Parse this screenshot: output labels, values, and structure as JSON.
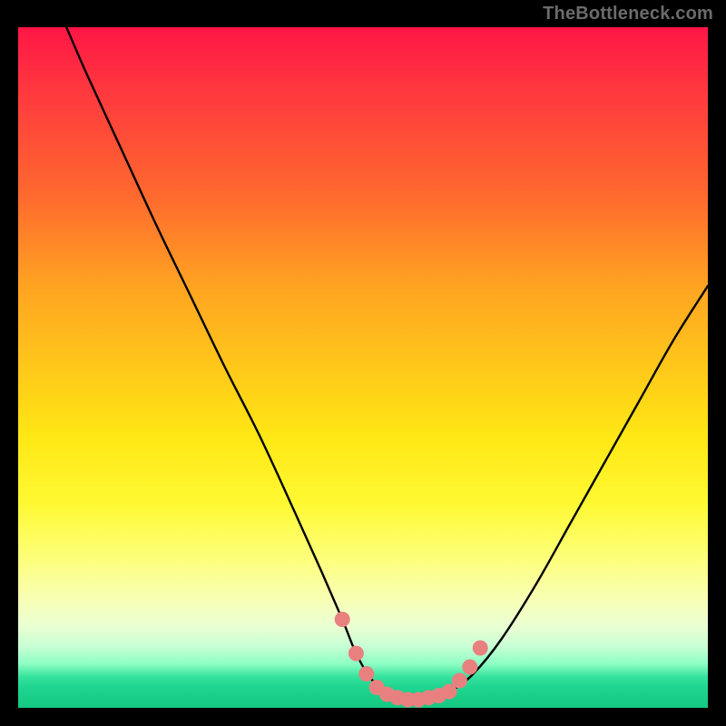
{
  "watermark": "TheBottleneck.com",
  "chart_data": {
    "type": "line",
    "title": "",
    "xlabel": "",
    "ylabel": "",
    "xlim": [
      0,
      100
    ],
    "ylim": [
      0,
      100
    ],
    "gradient_stops": [
      {
        "pos": 0,
        "color": "#ff1646"
      },
      {
        "pos": 0.1,
        "color": "#ff3a3e"
      },
      {
        "pos": 0.25,
        "color": "#ff6a2e"
      },
      {
        "pos": 0.38,
        "color": "#ffa321"
      },
      {
        "pos": 0.5,
        "color": "#ffc81a"
      },
      {
        "pos": 0.6,
        "color": "#ffe714"
      },
      {
        "pos": 0.7,
        "color": "#fff933"
      },
      {
        "pos": 0.78,
        "color": "#fdff7a"
      },
      {
        "pos": 0.84,
        "color": "#f8ffb4"
      },
      {
        "pos": 0.88,
        "color": "#eaffd2"
      },
      {
        "pos": 0.91,
        "color": "#c8ffd5"
      },
      {
        "pos": 0.935,
        "color": "#8effc3"
      },
      {
        "pos": 0.955,
        "color": "#34e29d"
      },
      {
        "pos": 0.97,
        "color": "#1fd58f"
      },
      {
        "pos": 0.985,
        "color": "#19cf88"
      },
      {
        "pos": 1.0,
        "color": "#15c982"
      }
    ],
    "series": [
      {
        "name": "bottleneck-curve",
        "x": [
          7,
          10,
          15,
          20,
          25,
          30,
          35,
          40,
          44,
          47,
          49,
          51,
          53,
          55,
          57,
          59,
          61,
          63,
          66,
          70,
          75,
          80,
          85,
          90,
          95,
          100
        ],
        "y": [
          100,
          93,
          82,
          71,
          60.5,
          50,
          40,
          29,
          20,
          13,
          8,
          4.5,
          2.5,
          1.6,
          1.2,
          1.2,
          1.6,
          2.6,
          5,
          10,
          18,
          27,
          36,
          45,
          54,
          62
        ]
      }
    ],
    "markers": {
      "name": "trough-markers",
      "color": "#e98080",
      "points": [
        {
          "x": 47,
          "y": 13
        },
        {
          "x": 49,
          "y": 8
        },
        {
          "x": 50.5,
          "y": 5
        },
        {
          "x": 52,
          "y": 3
        },
        {
          "x": 53.5,
          "y": 2
        },
        {
          "x": 55,
          "y": 1.5
        },
        {
          "x": 56.5,
          "y": 1.2
        },
        {
          "x": 58,
          "y": 1.2
        },
        {
          "x": 59.5,
          "y": 1.5
        },
        {
          "x": 61,
          "y": 1.8
        },
        {
          "x": 62.5,
          "y": 2.4
        },
        {
          "x": 64,
          "y": 4
        },
        {
          "x": 65.5,
          "y": 6
        },
        {
          "x": 67,
          "y": 8.8
        }
      ]
    }
  }
}
